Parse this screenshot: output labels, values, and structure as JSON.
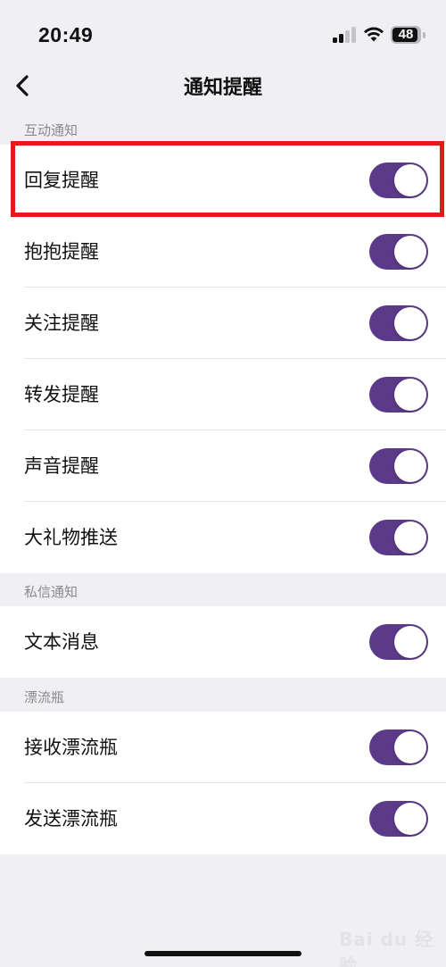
{
  "status_bar": {
    "time": "20:49",
    "battery": "48"
  },
  "nav": {
    "title": "通知提醒"
  },
  "sections": [
    {
      "header": "互动通知",
      "items": [
        {
          "label": "回复提醒",
          "enabled": true
        },
        {
          "label": "抱抱提醒",
          "enabled": true
        },
        {
          "label": "关注提醒",
          "enabled": true
        },
        {
          "label": "转发提醒",
          "enabled": true
        },
        {
          "label": "声音提醒",
          "enabled": true
        },
        {
          "label": "大礼物推送",
          "enabled": true
        }
      ]
    },
    {
      "header": "私信通知",
      "items": [
        {
          "label": "文本消息",
          "enabled": true
        }
      ]
    },
    {
      "header": "漂流瓶",
      "items": [
        {
          "label": "接收漂流瓶",
          "enabled": true
        },
        {
          "label": "发送漂流瓶",
          "enabled": true
        }
      ]
    }
  ],
  "watermark": {
    "text": "Bai du 经验"
  },
  "colors": {
    "toggle_on": "#5b3a89",
    "highlight": "#e41b1b",
    "background": "#efeff4"
  }
}
